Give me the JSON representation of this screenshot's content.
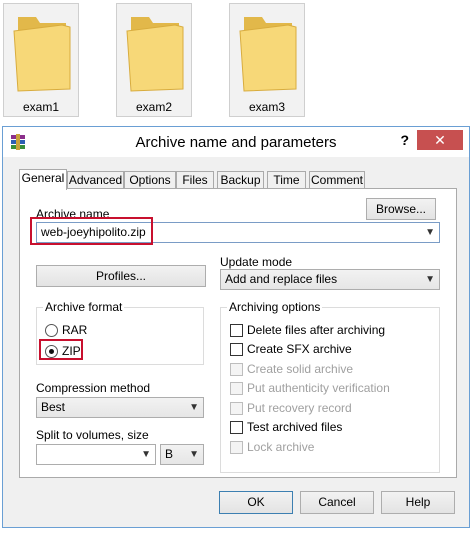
{
  "folders": [
    {
      "label": "exam1"
    },
    {
      "label": "exam2"
    },
    {
      "label": "exam3"
    }
  ],
  "dialog": {
    "title": "Archive name and parameters",
    "help_symbol": "?",
    "close_symbol": "✕",
    "tabs": [
      {
        "label": "General",
        "active": true
      },
      {
        "label": "Advanced"
      },
      {
        "label": "Options"
      },
      {
        "label": "Files"
      },
      {
        "label": "Backup"
      },
      {
        "label": "Time"
      },
      {
        "label": "Comment"
      }
    ],
    "archive_name_label": "Archive name",
    "browse_label": "Browse...",
    "archive_name_value": "web-joeyhipolito.zip",
    "profiles_label": "Profiles...",
    "update_mode_label": "Update mode",
    "update_mode_value": "Add and replace files",
    "archive_format_label": "Archive format",
    "formats": [
      {
        "label": "RAR",
        "selected": false
      },
      {
        "label": "ZIP",
        "selected": true
      }
    ],
    "archiving_options_label": "Archiving options",
    "options": [
      {
        "label": "Delete files after archiving",
        "enabled": true,
        "checked": false
      },
      {
        "label": "Create SFX archive",
        "enabled": true,
        "checked": false
      },
      {
        "label": "Create solid archive",
        "enabled": false,
        "checked": false
      },
      {
        "label": "Put authenticity verification",
        "enabled": false,
        "checked": false
      },
      {
        "label": "Put recovery record",
        "enabled": false,
        "checked": false
      },
      {
        "label": "Test archived files",
        "enabled": true,
        "checked": false
      },
      {
        "label": "Lock archive",
        "enabled": false,
        "checked": false
      }
    ],
    "compression_label": "Compression method",
    "compression_value": "Best",
    "split_label": "Split to volumes, size",
    "split_value": "",
    "split_unit": "B",
    "ok_label": "OK",
    "cancel_label": "Cancel",
    "help_label": "Help"
  },
  "colors": {
    "highlight": "#c8102e",
    "folder": "#f5d46f",
    "close": "#c75050"
  }
}
